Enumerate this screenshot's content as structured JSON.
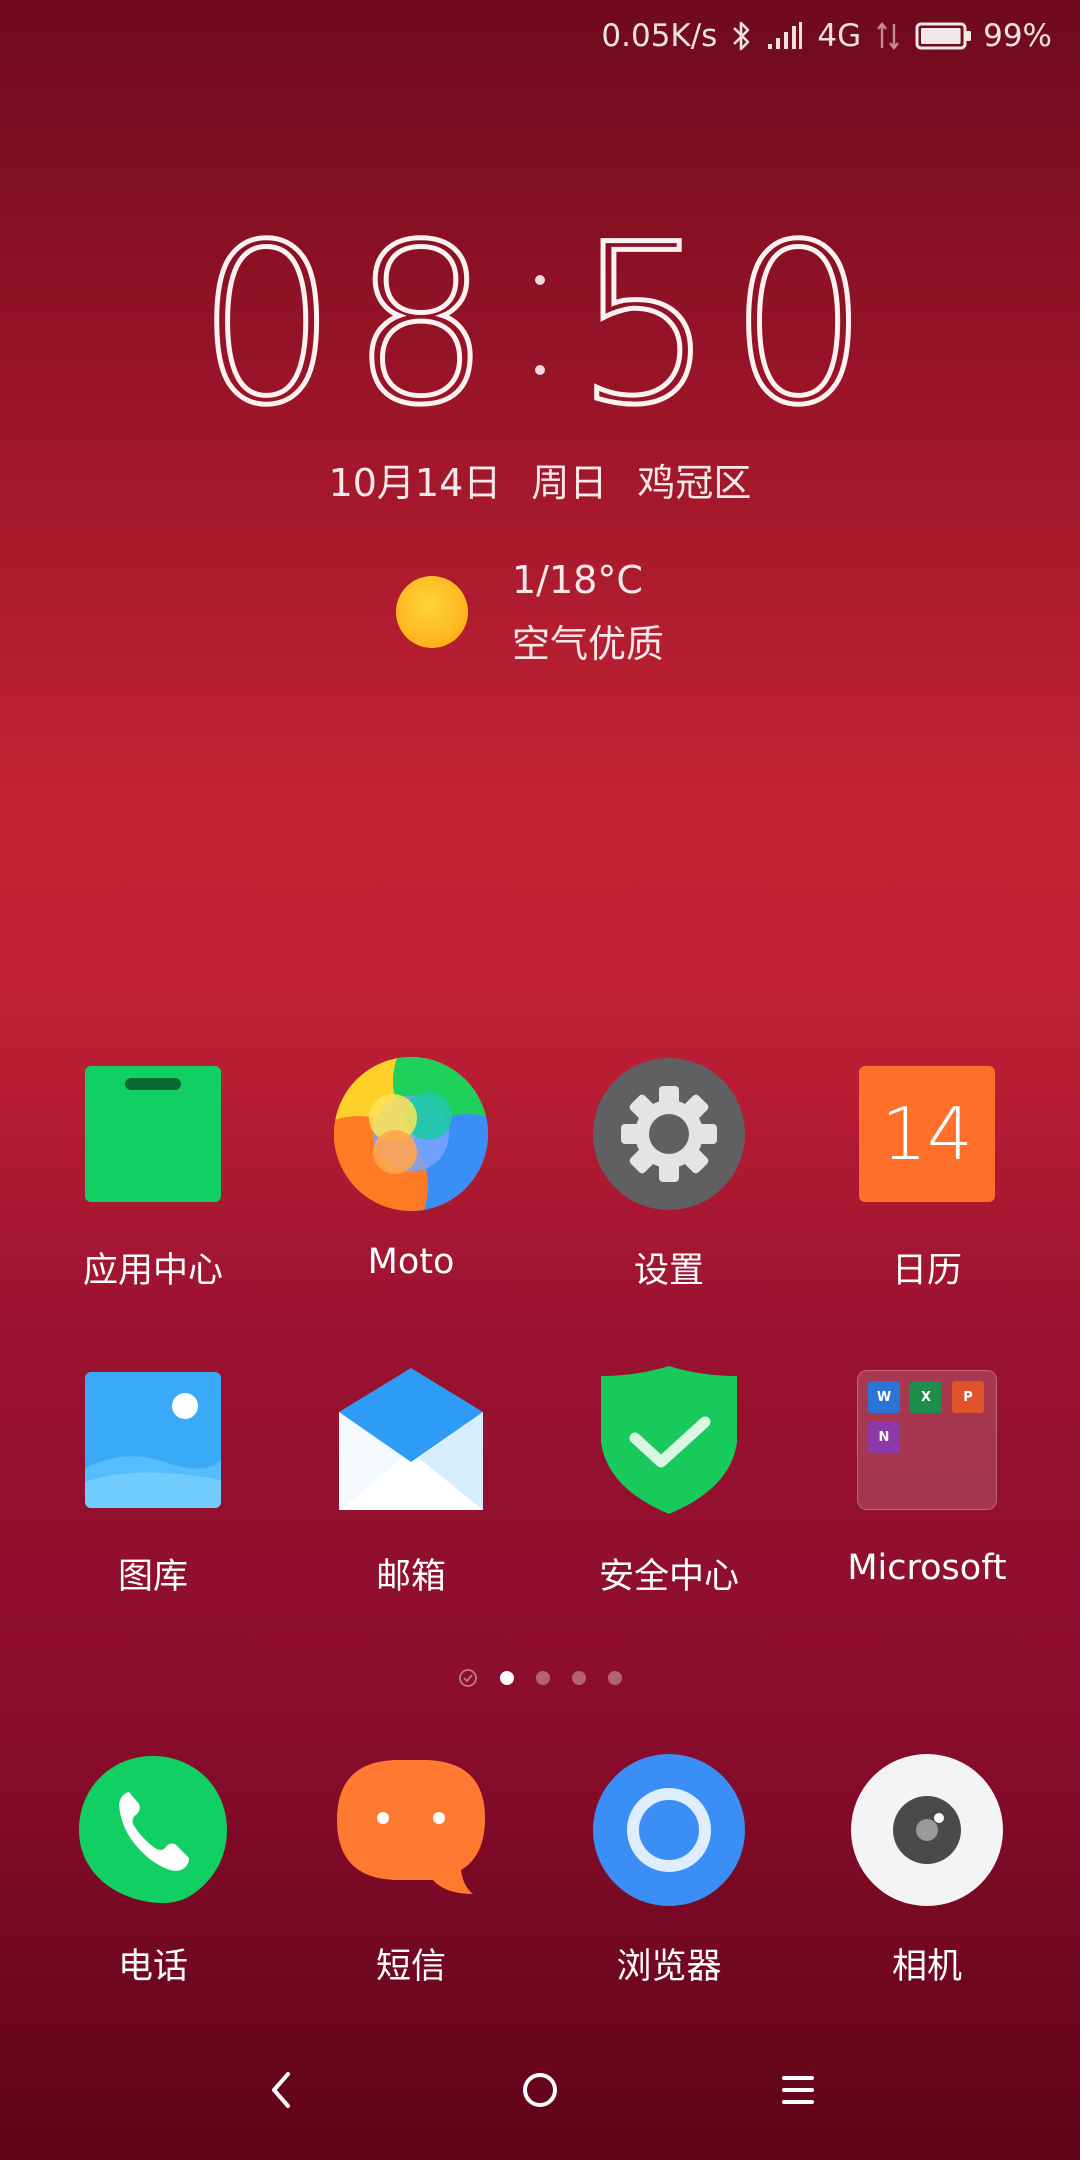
{
  "status_bar": {
    "net_speed": "0.05K/s",
    "network": "4G",
    "battery": "99%",
    "battery_level": 0.99
  },
  "clock": {
    "hours": "08",
    "minutes": "50"
  },
  "date_line": "10月14日 周日 鸡冠区",
  "weather": {
    "temperature": "1/18°C",
    "air_quality": "空气优质"
  },
  "apps": [
    {
      "label": "应用中心",
      "icon": "app-store-icon"
    },
    {
      "label": "Moto",
      "icon": "moto-icon"
    },
    {
      "label": "设置",
      "icon": "gear-icon"
    },
    {
      "label": "日历",
      "icon": "calendar-icon",
      "day": "14"
    },
    {
      "label": "图库",
      "icon": "gallery-icon"
    },
    {
      "label": "邮箱",
      "icon": "mail-icon"
    },
    {
      "label": "安全中心",
      "icon": "shield-icon"
    },
    {
      "label": "Microsoft",
      "icon": "folder-icon"
    }
  ],
  "dock": [
    {
      "label": "电话",
      "icon": "phone-icon"
    },
    {
      "label": "短信",
      "icon": "message-icon"
    },
    {
      "label": "浏览器",
      "icon": "browser-icon"
    },
    {
      "label": "相机",
      "icon": "camera-icon"
    }
  ],
  "page_indicator": {
    "pages": 4,
    "current": 1
  },
  "colors": {
    "store_green": "#12cf63",
    "calendar_orange": "#ff6f2a",
    "settings_gray": "#606062",
    "shield_green": "#18c95b",
    "phone_green": "#12cf63",
    "message_orange": "#ff7a30",
    "browser_blue": "#3a8ef5"
  }
}
